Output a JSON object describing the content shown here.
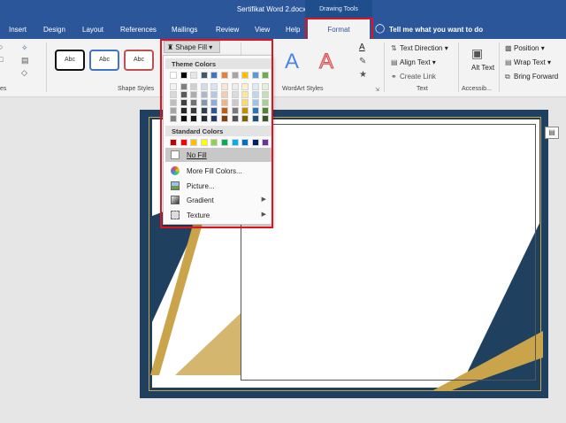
{
  "window": {
    "title": "Sertifikat Word 2.docx - Word",
    "context_label": "Drawing Tools"
  },
  "tabs": [
    "Insert",
    "Design",
    "Layout",
    "References",
    "Mailings",
    "Review",
    "View",
    "Help"
  ],
  "active_tab": "Format",
  "tellme": "Tell me what you want to do",
  "ribbon": {
    "shape_styles": {
      "label": "Shape Styles",
      "samples": [
        "Abc",
        "Abc",
        "Abc"
      ]
    },
    "shape_fill_label": "Shape Fill",
    "wordart": {
      "label": "WordArt Styles",
      "sample_a1": "A",
      "sample_a2": "A",
      "a_small": "A"
    },
    "text": {
      "label": "Text",
      "direction": "Text Direction",
      "align": "Align Text",
      "link": "Create Link"
    },
    "alt_text": "Alt Text",
    "accessibility": "Accessib...",
    "arrange": {
      "position": "Position",
      "wrap": "Wrap Text",
      "bring_forward": "Bring Forward"
    },
    "left_group_fragment": "es"
  },
  "dropdown": {
    "theme_colors_label": "Theme Colors",
    "standard_colors_label": "Standard Colors",
    "theme_colors": [
      [
        "#ffffff",
        "#f2f2f2",
        "#d9d9d9",
        "#bfbfbf",
        "#a6a6a6",
        "#808080"
      ],
      [
        "#000000",
        "#7f7f7f",
        "#595959",
        "#404040",
        "#262626",
        "#0d0d0d"
      ],
      [
        "#e7e6e6",
        "#d0cece",
        "#aeabab",
        "#757171",
        "#3b3838",
        "#171616"
      ],
      [
        "#44546a",
        "#d6dce5",
        "#adb9ca",
        "#8497b0",
        "#333f50",
        "#222a35"
      ],
      [
        "#4472c4",
        "#dae3f3",
        "#b4c7e7",
        "#8faadc",
        "#2f5597",
        "#1f3864"
      ],
      [
        "#ed7d31",
        "#fbe5d6",
        "#f8cbad",
        "#f4b183",
        "#c55a11",
        "#843c0c"
      ],
      [
        "#a5a5a5",
        "#ededed",
        "#dbdbdb",
        "#c9c9c9",
        "#7b7b7b",
        "#525252"
      ],
      [
        "#ffc000",
        "#fff2cc",
        "#ffe699",
        "#ffd966",
        "#bf9000",
        "#7f6000"
      ],
      [
        "#5b9bd5",
        "#deebf7",
        "#bdd7ee",
        "#9dc3e6",
        "#2e75b6",
        "#1f4e79"
      ],
      [
        "#70ad47",
        "#e2f0d9",
        "#c5e0b4",
        "#a9d18e",
        "#548235",
        "#385723"
      ]
    ],
    "standard_colors": [
      "#c00000",
      "#ff0000",
      "#ffc000",
      "#ffff00",
      "#92d050",
      "#00b050",
      "#00b0f0",
      "#0070c0",
      "#002060",
      "#7030a0"
    ],
    "items": [
      {
        "label": "No Fill",
        "icon": "no-fill-icon"
      },
      {
        "label": "More Fill Colors...",
        "icon": "palette-icon"
      },
      {
        "label": "Picture...",
        "icon": "picture-icon"
      },
      {
        "label": "Gradient",
        "icon": "gradient-icon"
      },
      {
        "label": "Texture",
        "icon": "texture-icon"
      }
    ]
  },
  "colors": {
    "accent": "#2b579a",
    "highlight": "#e0141e",
    "cert_bg": "#20405f",
    "gold": "#c9a44a"
  }
}
